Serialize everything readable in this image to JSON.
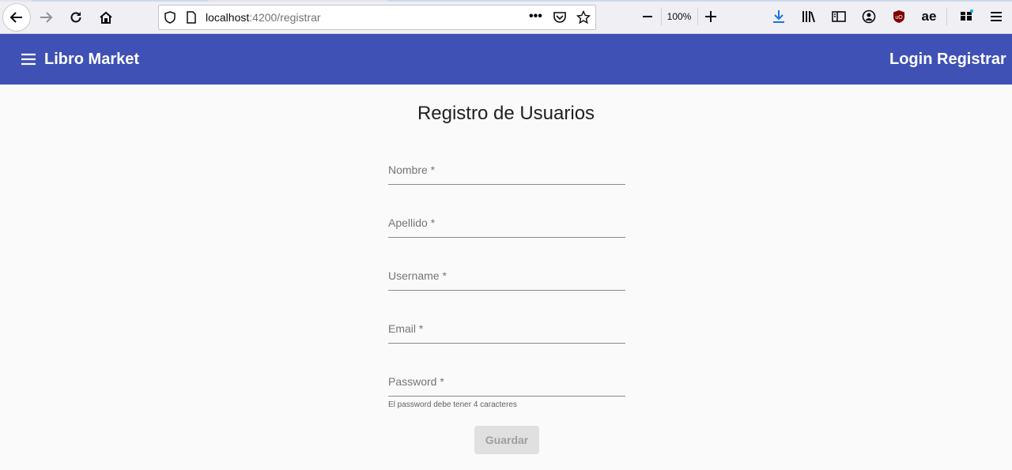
{
  "browser": {
    "url_host": "localhost",
    "url_path": ":4200/registrar",
    "zoom_level": "100%",
    "icons": {
      "back": "arrow-left-icon",
      "forward": "arrow-right-icon",
      "reload": "reload-icon",
      "home": "home-icon",
      "shield": "shield-icon",
      "page": "page-icon",
      "more": "more-dots-icon",
      "pocket": "pocket-icon",
      "bookmark": "star-icon",
      "zoom_out": "minus-icon",
      "zoom_in": "plus-icon",
      "download": "download-icon",
      "library": "library-icon",
      "sidebar": "sidebar-icon",
      "account": "account-icon",
      "ublock": "ublock-icon",
      "extension_ae": "ae",
      "extensions": "extensions-icon",
      "menu": "hamburger-icon"
    },
    "accent_color": "#1a73e8"
  },
  "toolbar": {
    "brand": "Libro Market",
    "login": "Login",
    "register": "Registrar",
    "color": "#3f51b5"
  },
  "form": {
    "title": "Registro de Usuarios",
    "fields": [
      {
        "label": "Nombre *"
      },
      {
        "label": "Apellido *"
      },
      {
        "label": "Username *"
      },
      {
        "label": "Email *"
      },
      {
        "label": "Password *"
      }
    ],
    "password_hint": "El password debe tener 4 caracteres",
    "save_label": "Guardar"
  }
}
